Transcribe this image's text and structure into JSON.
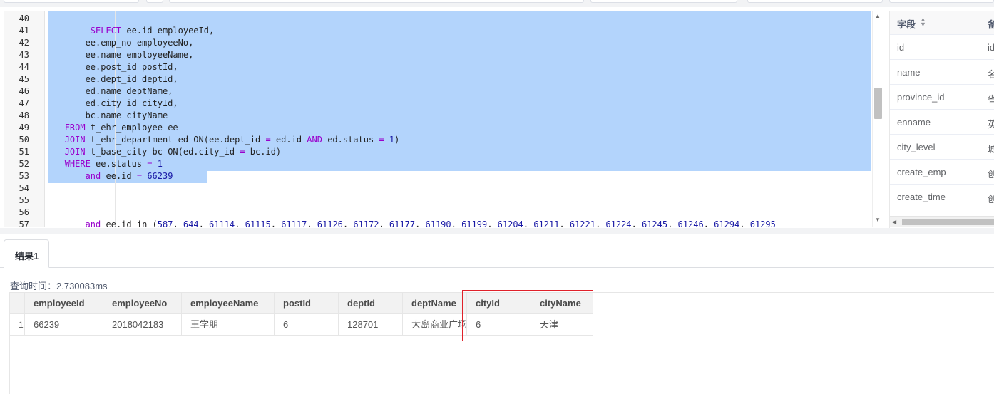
{
  "editor": {
    "line_numbers": [
      "40",
      "41",
      "42",
      "43",
      "44",
      "45",
      "46",
      "47",
      "48",
      "49",
      "50",
      "51",
      "52",
      "53",
      "54",
      "55",
      "56",
      "57"
    ],
    "lines": [
      [],
      [
        {
          "t": "        ",
          "c": "plain"
        },
        {
          "t": "SELECT",
          "c": "kw"
        },
        {
          "t": " ee.id employeeId,",
          "c": "plain"
        }
      ],
      [
        {
          "t": "       ee.emp_no employeeNo,",
          "c": "plain"
        }
      ],
      [
        {
          "t": "       ee.name employeeName,",
          "c": "plain"
        }
      ],
      [
        {
          "t": "       ee.post_id postId,",
          "c": "plain"
        }
      ],
      [
        {
          "t": "       ee.dept_id deptId,",
          "c": "plain"
        }
      ],
      [
        {
          "t": "       ed.name deptName,",
          "c": "plain"
        }
      ],
      [
        {
          "t": "       ed.city_id cityId,",
          "c": "plain"
        }
      ],
      [
        {
          "t": "       bc.name cityName",
          "c": "plain"
        }
      ],
      [
        {
          "t": "   ",
          "c": "plain"
        },
        {
          "t": "FROM",
          "c": "kw"
        },
        {
          "t": " t_ehr_employee ee",
          "c": "plain"
        }
      ],
      [
        {
          "t": "   ",
          "c": "plain"
        },
        {
          "t": "JOIN",
          "c": "kw"
        },
        {
          "t": " t_ehr_department ed ON(ee.dept_id ",
          "c": "plain"
        },
        {
          "t": "=",
          "c": "op"
        },
        {
          "t": " ed.id ",
          "c": "plain"
        },
        {
          "t": "AND",
          "c": "kw"
        },
        {
          "t": " ed.status ",
          "c": "plain"
        },
        {
          "t": "=",
          "c": "op"
        },
        {
          "t": " ",
          "c": "plain"
        },
        {
          "t": "1",
          "c": "num"
        },
        {
          "t": ")",
          "c": "plain"
        }
      ],
      [
        {
          "t": "   ",
          "c": "plain"
        },
        {
          "t": "JOIN",
          "c": "kw"
        },
        {
          "t": " t_base_city bc ON(ed.city_id ",
          "c": "plain"
        },
        {
          "t": "=",
          "c": "op"
        },
        {
          "t": " bc.id)",
          "c": "plain"
        }
      ],
      [
        {
          "t": "   ",
          "c": "plain"
        },
        {
          "t": "WHERE",
          "c": "kw"
        },
        {
          "t": " ee.status ",
          "c": "plain"
        },
        {
          "t": "=",
          "c": "op"
        },
        {
          "t": " ",
          "c": "plain"
        },
        {
          "t": "1",
          "c": "num"
        }
      ],
      [
        {
          "t": "       ",
          "c": "plain"
        },
        {
          "t": "and",
          "c": "kw"
        },
        {
          "t": " ee.id ",
          "c": "plain"
        },
        {
          "t": "=",
          "c": "op"
        },
        {
          "t": " ",
          "c": "plain"
        },
        {
          "t": "66239",
          "c": "num"
        }
      ],
      [],
      [],
      [],
      [
        {
          "t": "       ",
          "c": "plain"
        },
        {
          "t": "and",
          "c": "kw"
        },
        {
          "t": " ee.id in (",
          "c": "plain"
        },
        {
          "t": "587",
          "c": "num"
        },
        {
          "t": ", ",
          "c": "plain"
        },
        {
          "t": "644",
          "c": "num"
        },
        {
          "t": ", ",
          "c": "plain"
        },
        {
          "t": "61114",
          "c": "num"
        },
        {
          "t": ", ",
          "c": "plain"
        },
        {
          "t": "61115",
          "c": "num"
        },
        {
          "t": ", ",
          "c": "plain"
        },
        {
          "t": "61117",
          "c": "num"
        },
        {
          "t": ", ",
          "c": "plain"
        },
        {
          "t": "61126",
          "c": "num"
        },
        {
          "t": ", ",
          "c": "plain"
        },
        {
          "t": "61172",
          "c": "num"
        },
        {
          "t": ", ",
          "c": "plain"
        },
        {
          "t": "61177",
          "c": "num"
        },
        {
          "t": ", ",
          "c": "plain"
        },
        {
          "t": "61190",
          "c": "num"
        },
        {
          "t": ", ",
          "c": "plain"
        },
        {
          "t": "61199",
          "c": "num"
        },
        {
          "t": ", ",
          "c": "plain"
        },
        {
          "t": "61204",
          "c": "num"
        },
        {
          "t": ", ",
          "c": "plain"
        },
        {
          "t": "61211",
          "c": "num"
        },
        {
          "t": ", ",
          "c": "plain"
        },
        {
          "t": "61221",
          "c": "num"
        },
        {
          "t": ", ",
          "c": "plain"
        },
        {
          "t": "61224",
          "c": "num"
        },
        {
          "t": ", ",
          "c": "plain"
        },
        {
          "t": "61245",
          "c": "num"
        },
        {
          "t": ", ",
          "c": "plain"
        },
        {
          "t": "61246",
          "c": "num"
        },
        {
          "t": ", ",
          "c": "plain"
        },
        {
          "t": "61294",
          "c": "num"
        },
        {
          "t": ", ",
          "c": "plain"
        },
        {
          "t": "61295",
          "c": "num"
        }
      ]
    ]
  },
  "schema_panel": {
    "header_label": "字段",
    "sort_icon": "sort-icon",
    "header_col2": "备",
    "rows": [
      {
        "name": "id",
        "col2": "id"
      },
      {
        "name": "name",
        "col2": "名"
      },
      {
        "name": "province_id",
        "col2": "省"
      },
      {
        "name": "enname",
        "col2": "英"
      },
      {
        "name": "city_level",
        "col2": "城"
      },
      {
        "name": "create_emp",
        "col2": "创"
      },
      {
        "name": "create_time",
        "col2": "创"
      }
    ]
  },
  "results": {
    "tab_label": "结果1",
    "query_time": "查询时间：2.730083ms",
    "columns": [
      "employeeId",
      "employeeNo",
      "employeeName",
      "postId",
      "deptId",
      "deptName",
      "cityId",
      "cityName"
    ],
    "rows": [
      {
        "num": "1",
        "cells": [
          "66239",
          "2018042183",
          "王学朋",
          "6",
          "128701",
          "大岛商业广场",
          "6",
          "天津"
        ]
      }
    ]
  },
  "colors": {
    "selection": "#b3d4fc",
    "keyword": "#9900cc",
    "number": "#1a1aa6",
    "highlight_border": "#e0212a"
  }
}
